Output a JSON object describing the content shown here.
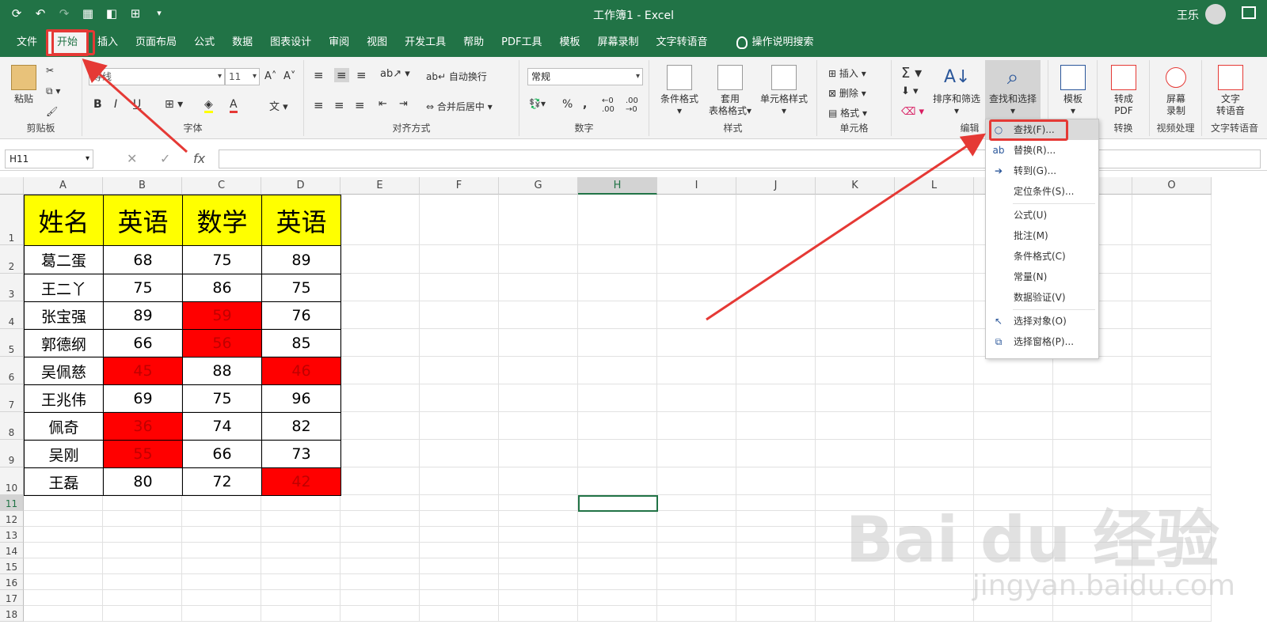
{
  "title": {
    "window": "工作簿1  -  Excel",
    "user": "王乐"
  },
  "tabs": [
    "文件",
    "开始",
    "插入",
    "页面布局",
    "公式",
    "数据",
    "图表设计",
    "审阅",
    "视图",
    "开发工具",
    "帮助",
    "PDF工具",
    "模板",
    "屏幕录制",
    "文字转语音"
  ],
  "tell_me": "操作说明搜索",
  "ribbon": {
    "clipboard": {
      "paste": "粘贴",
      "label": "剪贴板"
    },
    "font": {
      "name": "等线",
      "size": "11",
      "bold": "B",
      "italic": "I",
      "underline": "U",
      "label": "字体"
    },
    "alignment": {
      "wrap": "自动换行",
      "merge": "合并后居中",
      "label": "对齐方式"
    },
    "number": {
      "format": "常规",
      "label": "数字"
    },
    "styles": {
      "conditional": "条件格式",
      "table_line1": "套用",
      "table_line2": "表格格式",
      "cell_styles": "单元格样式",
      "label": "样式"
    },
    "cells": {
      "insert": "插入",
      "delete": "删除",
      "format": "格式",
      "label": "单元格"
    },
    "editing": {
      "sort": "排序和筛选",
      "find": "查找和选择",
      "label": "编辑"
    },
    "template": {
      "label": "模板"
    },
    "convert": {
      "line1": "转成",
      "line2": "PDF",
      "label": "转换"
    },
    "record": {
      "line1": "屏幕",
      "line2": "录制",
      "label": "视频处理"
    },
    "tts": {
      "line1": "文字",
      "line2": "转语音",
      "label": "文字转语音"
    }
  },
  "formula_bar": {
    "name_box": "H11",
    "fx": "fx",
    "cancel": "✕",
    "enter": "✓"
  },
  "columns": [
    "A",
    "B",
    "C",
    "D",
    "E",
    "F",
    "G",
    "H",
    "I",
    "J",
    "K",
    "L",
    "M",
    "N",
    "O"
  ],
  "rows": [
    "1",
    "2",
    "3",
    "4",
    "5",
    "6",
    "7",
    "8",
    "9",
    "10",
    "11",
    "12",
    "13",
    "14",
    "15",
    "16",
    "17",
    "18"
  ],
  "table": {
    "headers": [
      "姓名",
      "英语",
      "数学",
      "英语"
    ],
    "rows": [
      {
        "name": "葛二蛋",
        "v": [
          "68",
          "75",
          "89"
        ],
        "red": [
          false,
          false,
          false
        ]
      },
      {
        "name": "王二丫",
        "v": [
          "75",
          "86",
          "75"
        ],
        "red": [
          false,
          false,
          false
        ]
      },
      {
        "name": "张宝强",
        "v": [
          "89",
          "59",
          "76"
        ],
        "red": [
          false,
          true,
          false
        ]
      },
      {
        "name": "郭德纲",
        "v": [
          "66",
          "56",
          "85"
        ],
        "red": [
          false,
          true,
          false
        ]
      },
      {
        "name": "吴佩慈",
        "v": [
          "45",
          "88",
          "46"
        ],
        "red": [
          true,
          false,
          true
        ]
      },
      {
        "name": "王兆伟",
        "v": [
          "69",
          "75",
          "96"
        ],
        "red": [
          false,
          false,
          false
        ]
      },
      {
        "name": "佩奇",
        "v": [
          "36",
          "74",
          "82"
        ],
        "red": [
          true,
          false,
          false
        ]
      },
      {
        "name": "吴刚",
        "v": [
          "55",
          "66",
          "73"
        ],
        "red": [
          true,
          false,
          false
        ]
      },
      {
        "name": "王磊",
        "v": [
          "80",
          "72",
          "42"
        ],
        "red": [
          false,
          false,
          true
        ]
      }
    ]
  },
  "menu": [
    {
      "label": "查找(F)...",
      "icon": "search-icon"
    },
    {
      "label": "替换(R)...",
      "icon": "replace-icon"
    },
    {
      "label": "转到(G)...",
      "icon": "arrow-right-icon"
    },
    {
      "label": "定位条件(S)...",
      "icon": ""
    },
    {
      "label": "公式(U)",
      "icon": ""
    },
    {
      "label": "批注(M)",
      "icon": ""
    },
    {
      "label": "条件格式(C)",
      "icon": ""
    },
    {
      "label": "常量(N)",
      "icon": ""
    },
    {
      "label": "数据验证(V)",
      "icon": ""
    },
    {
      "label": "选择对象(O)",
      "icon": "cursor-icon"
    },
    {
      "label": "选择窗格(P)...",
      "icon": "selection-pane-icon"
    }
  ],
  "watermark": {
    "brand": "Bai du 经验",
    "url": "jingyan.baidu.com"
  },
  "colors": {
    "excel_green": "#217346",
    "highlight_red": "#ff0000",
    "header_yellow": "#ffff00",
    "annotation_red": "#e53935"
  }
}
